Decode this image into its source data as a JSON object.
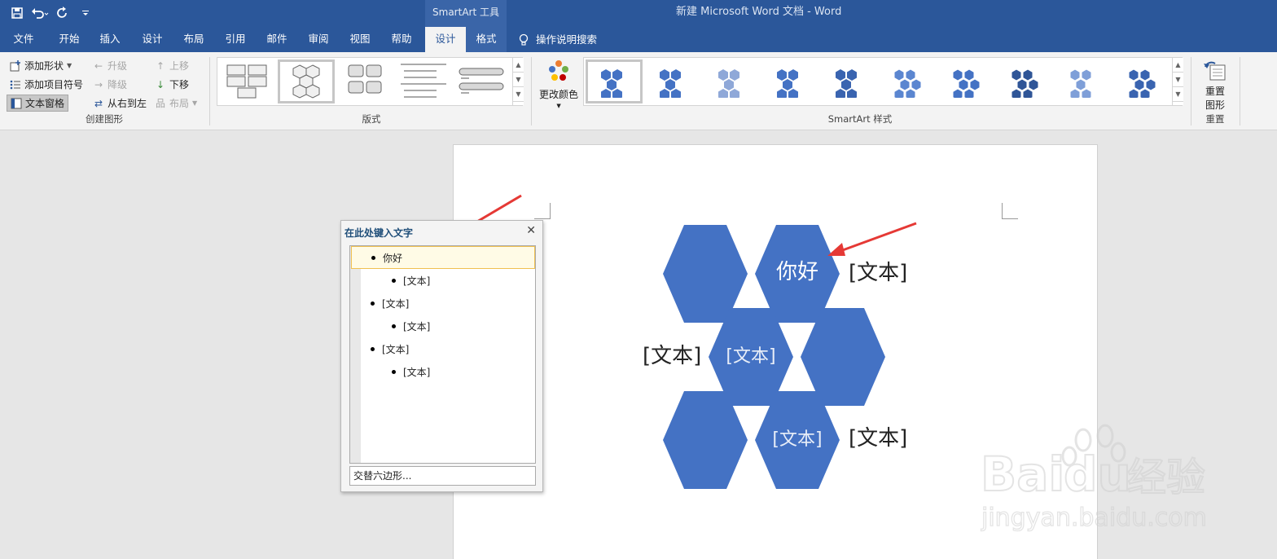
{
  "titlebar": {
    "context_group": "SmartArt 工具",
    "doc_title": "新建 Microsoft Word 文档  -  Word"
  },
  "tabs": [
    "文件",
    "开始",
    "插入",
    "设计",
    "布局",
    "引用",
    "邮件",
    "审阅",
    "视图",
    "帮助"
  ],
  "ctx_tabs": [
    "设计",
    "格式"
  ],
  "active_tab": "设计",
  "tell_me": "操作说明搜索",
  "ribbon": {
    "create_group": {
      "label": "创建图形",
      "add_shape": "添加形状",
      "add_bullet": "添加项目符号",
      "text_pane": "文本窗格",
      "promote": "升级",
      "demote": "降级",
      "right_to_left": "从右到左",
      "move_up": "上移",
      "move_down": "下移",
      "layout": "布局"
    },
    "layouts_group": {
      "label": "版式"
    },
    "styles_group": {
      "label": "SmartArt 样式",
      "change_colors": "更改颜色"
    },
    "reset_group": {
      "label": "重置",
      "reset_line1": "重置",
      "reset_line2": "图形"
    }
  },
  "text_pane": {
    "title": "在此处键入文字",
    "items": [
      {
        "text": "你好",
        "level": 1
      },
      {
        "text": "[文本]",
        "level": 2
      },
      {
        "text": "[文本]",
        "level": 1
      },
      {
        "text": "[文本]",
        "level": 2
      },
      {
        "text": "[文本]",
        "level": 1
      },
      {
        "text": "[文本]",
        "level": 2
      }
    ],
    "footer": "交替六边形..."
  },
  "smartart": {
    "hex_color": "#4472c4",
    "hex_top_right": "你好",
    "hex_middle_left": "[文本]",
    "hex_bottom_right": "[文本]",
    "side_text_1": "[文本]",
    "side_text_2": "[文本]",
    "side_text_3": "[文本]"
  },
  "watermark": {
    "brand": "Bai",
    "brand2": "du",
    "cn": "经验",
    "url": "jingyan.baidu.com"
  },
  "colors": {
    "ribbon_blue": "#2b579a",
    "annotation_red": "#e53935"
  }
}
